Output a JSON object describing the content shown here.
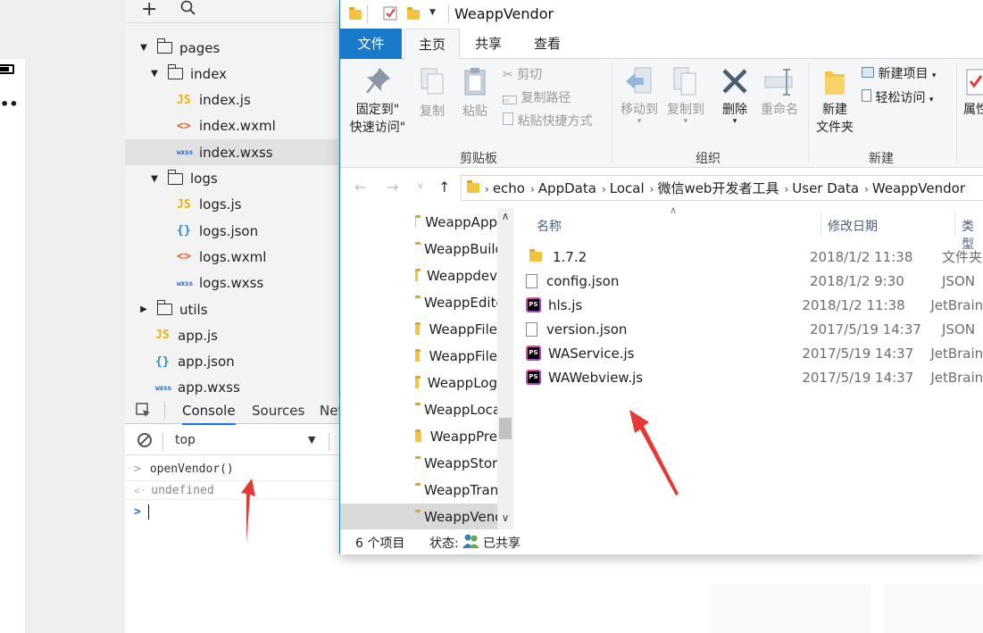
{
  "ide": {
    "toolbar": {
      "add_glyph": "+",
      "search_glyph": "⚲"
    },
    "tree": [
      {
        "label": "pages",
        "kind": "folder",
        "expanded": true,
        "depth": 0
      },
      {
        "label": "index",
        "kind": "folder",
        "expanded": true,
        "depth": 1
      },
      {
        "label": "index.js",
        "kind": "js",
        "depth": 2,
        "icon_text": "JS"
      },
      {
        "label": "index.wxml",
        "kind": "wxml",
        "depth": 2,
        "icon_text": "<>"
      },
      {
        "label": "index.wxss",
        "kind": "wxss",
        "depth": 2,
        "icon_text": "wxss",
        "selected": true
      },
      {
        "label": "logs",
        "kind": "folder",
        "expanded": true,
        "depth": 1
      },
      {
        "label": "logs.js",
        "kind": "js",
        "depth": 2,
        "icon_text": "JS"
      },
      {
        "label": "logs.json",
        "kind": "json",
        "depth": 2,
        "icon_text": "{}"
      },
      {
        "label": "logs.wxml",
        "kind": "wxml",
        "depth": 2,
        "icon_text": "<>"
      },
      {
        "label": "logs.wxss",
        "kind": "wxss",
        "depth": 2,
        "icon_text": "wxss"
      },
      {
        "label": "utils",
        "kind": "folder",
        "expanded": false,
        "depth": 0
      },
      {
        "label": "app.js",
        "kind": "js",
        "depth": 0,
        "icon_text": "JS"
      },
      {
        "label": "app.json",
        "kind": "json",
        "depth": 0,
        "icon_text": "{}"
      },
      {
        "label": "app.wxss",
        "kind": "wxss",
        "depth": 0,
        "icon_text": "wxss"
      }
    ],
    "console": {
      "tabs": [
        "Console",
        "Sources",
        "Net"
      ],
      "active_tab": "Console",
      "context": "top",
      "lines": [
        {
          "prefix": ">",
          "text": "openVendor()"
        },
        {
          "prefix": "<·",
          "text": "undefined"
        }
      ],
      "prompt": ">"
    }
  },
  "explorer": {
    "title": "WeappVendor",
    "ribbon_tabs": [
      "文件",
      "主页",
      "共享",
      "查看"
    ],
    "active_tab": "主页",
    "ribbon": {
      "pin_label_1": "固定到\"",
      "pin_label_2": "快速访问\"",
      "copy": "复制",
      "paste": "粘贴",
      "cut": "剪切",
      "copy_path": "复制路径",
      "paste_shortcut": "粘贴快捷方式",
      "move_to": "移动到",
      "copy_to": "复制到",
      "delete": "删除",
      "rename": "重命名",
      "new_folder_1": "新建",
      "new_folder_2": "文件夹",
      "new_item": "新建项目",
      "easy_access": "轻松访问",
      "properties": "属性",
      "group_clipboard": "剪贴板",
      "group_organize": "组织",
      "group_new": "新建"
    },
    "address": [
      "echo",
      "AppData",
      "Local",
      "微信web开发者工具",
      "User Data",
      "WeappVendor"
    ],
    "nav_items": [
      "WeappApp",
      "WeappBuild",
      "Weappdev",
      "WeappEditor",
      "WeappFile",
      "WeappFile",
      "WeappLog",
      "WeappLocal",
      "WeappPre",
      "WeappStorage",
      "WeappTrans",
      "WeappVendor"
    ],
    "columns": {
      "name": "名称",
      "date": "修改日期",
      "type": "类型"
    },
    "files": [
      {
        "name": "1.7.2",
        "date": "2018/1/2 11:38",
        "type": "文件夹",
        "icon": "folder-icon"
      },
      {
        "name": "config.json",
        "date": "2018/1/2 9:30",
        "type": "JSON",
        "icon": "document-icon"
      },
      {
        "name": "hls.js",
        "date": "2018/1/2 11:38",
        "type": "JetBrains",
        "icon": "phpstorm-icon"
      },
      {
        "name": "version.json",
        "date": "2017/5/19 14:37",
        "type": "JSON",
        "icon": "document-icon"
      },
      {
        "name": "WAService.js",
        "date": "2017/5/19 14:37",
        "type": "JetBrains",
        "icon": "phpstorm-icon"
      },
      {
        "name": "WAWebview.js",
        "date": "2017/5/19 14:37",
        "type": "JetBrains",
        "icon": "phpstorm-icon"
      }
    ],
    "status": {
      "count": "6 个项目",
      "state_label": "状态:",
      "state_value": "已共享"
    }
  },
  "colors": {
    "accent": "#1979ca",
    "arrow": "#e53935"
  }
}
